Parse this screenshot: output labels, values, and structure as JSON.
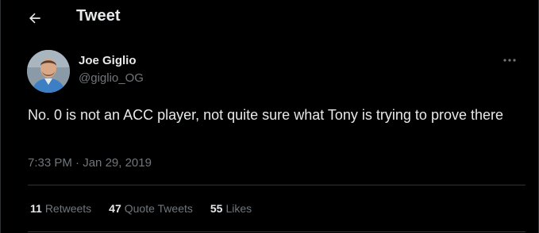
{
  "header": {
    "title": "Tweet",
    "back_icon": "arrow-left-icon"
  },
  "author": {
    "display_name": "Joe Giglio",
    "handle": "@giglio_OG",
    "avatar_icon": "user-avatar"
  },
  "tweet": {
    "text": "No. 0 is not an ACC player, not quite sure what Tony is trying to prove there",
    "time": "7:33 PM",
    "separator": "·",
    "date": "Jan 29, 2019",
    "more_icon": "more-horizontal-icon"
  },
  "stats": [
    {
      "count": "11",
      "label": "Retweets"
    },
    {
      "count": "47",
      "label": "Quote Tweets"
    },
    {
      "count": "55",
      "label": "Likes"
    }
  ],
  "colors": {
    "background": "#000000",
    "primary_text": "#e7e9ea",
    "secondary_text": "#71767b",
    "border": "#2f3336"
  }
}
